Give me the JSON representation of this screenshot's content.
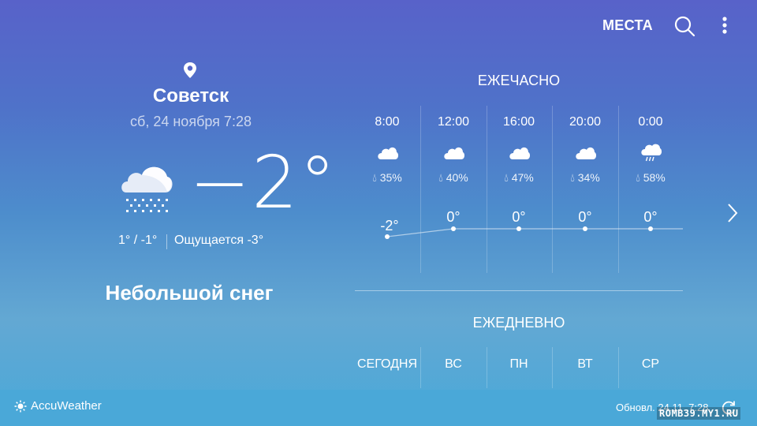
{
  "header": {
    "places_label": "МЕСТА",
    "search_icon": "search-icon",
    "more_icon": "more-vertical-icon"
  },
  "location": {
    "city": "Советск",
    "datetime": "сб, 24 ноября 7:28"
  },
  "current": {
    "temp": "−2°",
    "hilo": "1° / -1°",
    "feels": "Ощущается -3°",
    "condition": "Небольшой снег",
    "icon": "light-snow-icon"
  },
  "hourly": {
    "title": "ЕЖЕЧАСНО",
    "items": [
      {
        "time": "8:00",
        "precip": "35%",
        "temp": "-2°",
        "value": -2,
        "icon": "cloud-icon"
      },
      {
        "time": "12:00",
        "precip": "40%",
        "temp": "0°",
        "value": 0,
        "icon": "cloud-icon"
      },
      {
        "time": "16:00",
        "precip": "47%",
        "temp": "0°",
        "value": 0,
        "icon": "cloud-icon"
      },
      {
        "time": "20:00",
        "precip": "34%",
        "temp": "0°",
        "value": 0,
        "icon": "cloud-icon"
      },
      {
        "time": "0:00",
        "precip": "58%",
        "temp": "0°",
        "value": 0,
        "icon": "cloud-rain-icon"
      }
    ]
  },
  "daily": {
    "title": "ЕЖЕДНЕВНО",
    "days": [
      "СЕГОДНЯ",
      "ВС",
      "ПН",
      "ВТ",
      "СР"
    ]
  },
  "footer": {
    "brand": "AccuWeather",
    "updated": "Обновл.  24.11. 7:28",
    "watermark": "ROMB39.MY1.RU"
  },
  "colors": {
    "bg_top": "#5862c9",
    "bg_bottom": "#49a9d9",
    "text": "#ffffff"
  }
}
